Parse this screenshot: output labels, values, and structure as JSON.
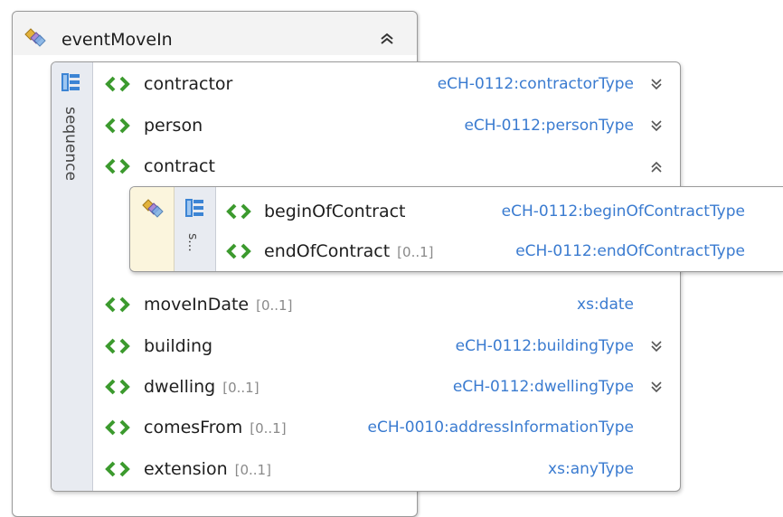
{
  "outer": {
    "title": "eventMoveIn",
    "chevron": "⌃"
  },
  "sequence": {
    "label": "sequence"
  },
  "inner": {
    "label": "s..."
  },
  "rows": [
    {
      "name": "contractor",
      "card": "",
      "type": "eCH-0112:contractorType",
      "chevron": "⌄"
    },
    {
      "name": "person",
      "card": "",
      "type": "eCH-0112:personType",
      "chevron": "⌄"
    },
    {
      "name": "contract",
      "card": "",
      "type": "",
      "chevron": "⌃"
    },
    {
      "name": "moveInDate",
      "card": "[0..1]",
      "type": "xs:date",
      "chevron": ""
    },
    {
      "name": "building",
      "card": "",
      "type": "eCH-0112:buildingType",
      "chevron": "⌄"
    },
    {
      "name": "dwelling",
      "card": "[0..1]",
      "type": "eCH-0112:dwellingType",
      "chevron": "⌄"
    },
    {
      "name": "comesFrom",
      "card": "[0..1]",
      "type": "eCH-0010:addressInformationType",
      "chevron": ""
    },
    {
      "name": "extension",
      "card": "[0..1]",
      "type": "xs:anyType",
      "chevron": ""
    }
  ],
  "inner_rows": [
    {
      "name": "beginOfContract",
      "card": "",
      "type": "eCH-0112:beginOfContractType"
    },
    {
      "name": "endOfContract",
      "card": "[0..1]",
      "type": "eCH-0112:endOfContractType"
    }
  ],
  "colors": {
    "element_icon": "#3c9a2e",
    "type_text": "#3a7bd0",
    "cardinality_text": "#8a8a8a",
    "sequence_strip": "#e8ebf1",
    "complex_strip": "#fbf5dd"
  },
  "icons": {
    "complex_type": "complex-type-icon",
    "sequence": "sequence-icon",
    "element": "element-icon",
    "collapse": "chevron-up-icon",
    "expand": "chevron-down-icon"
  }
}
